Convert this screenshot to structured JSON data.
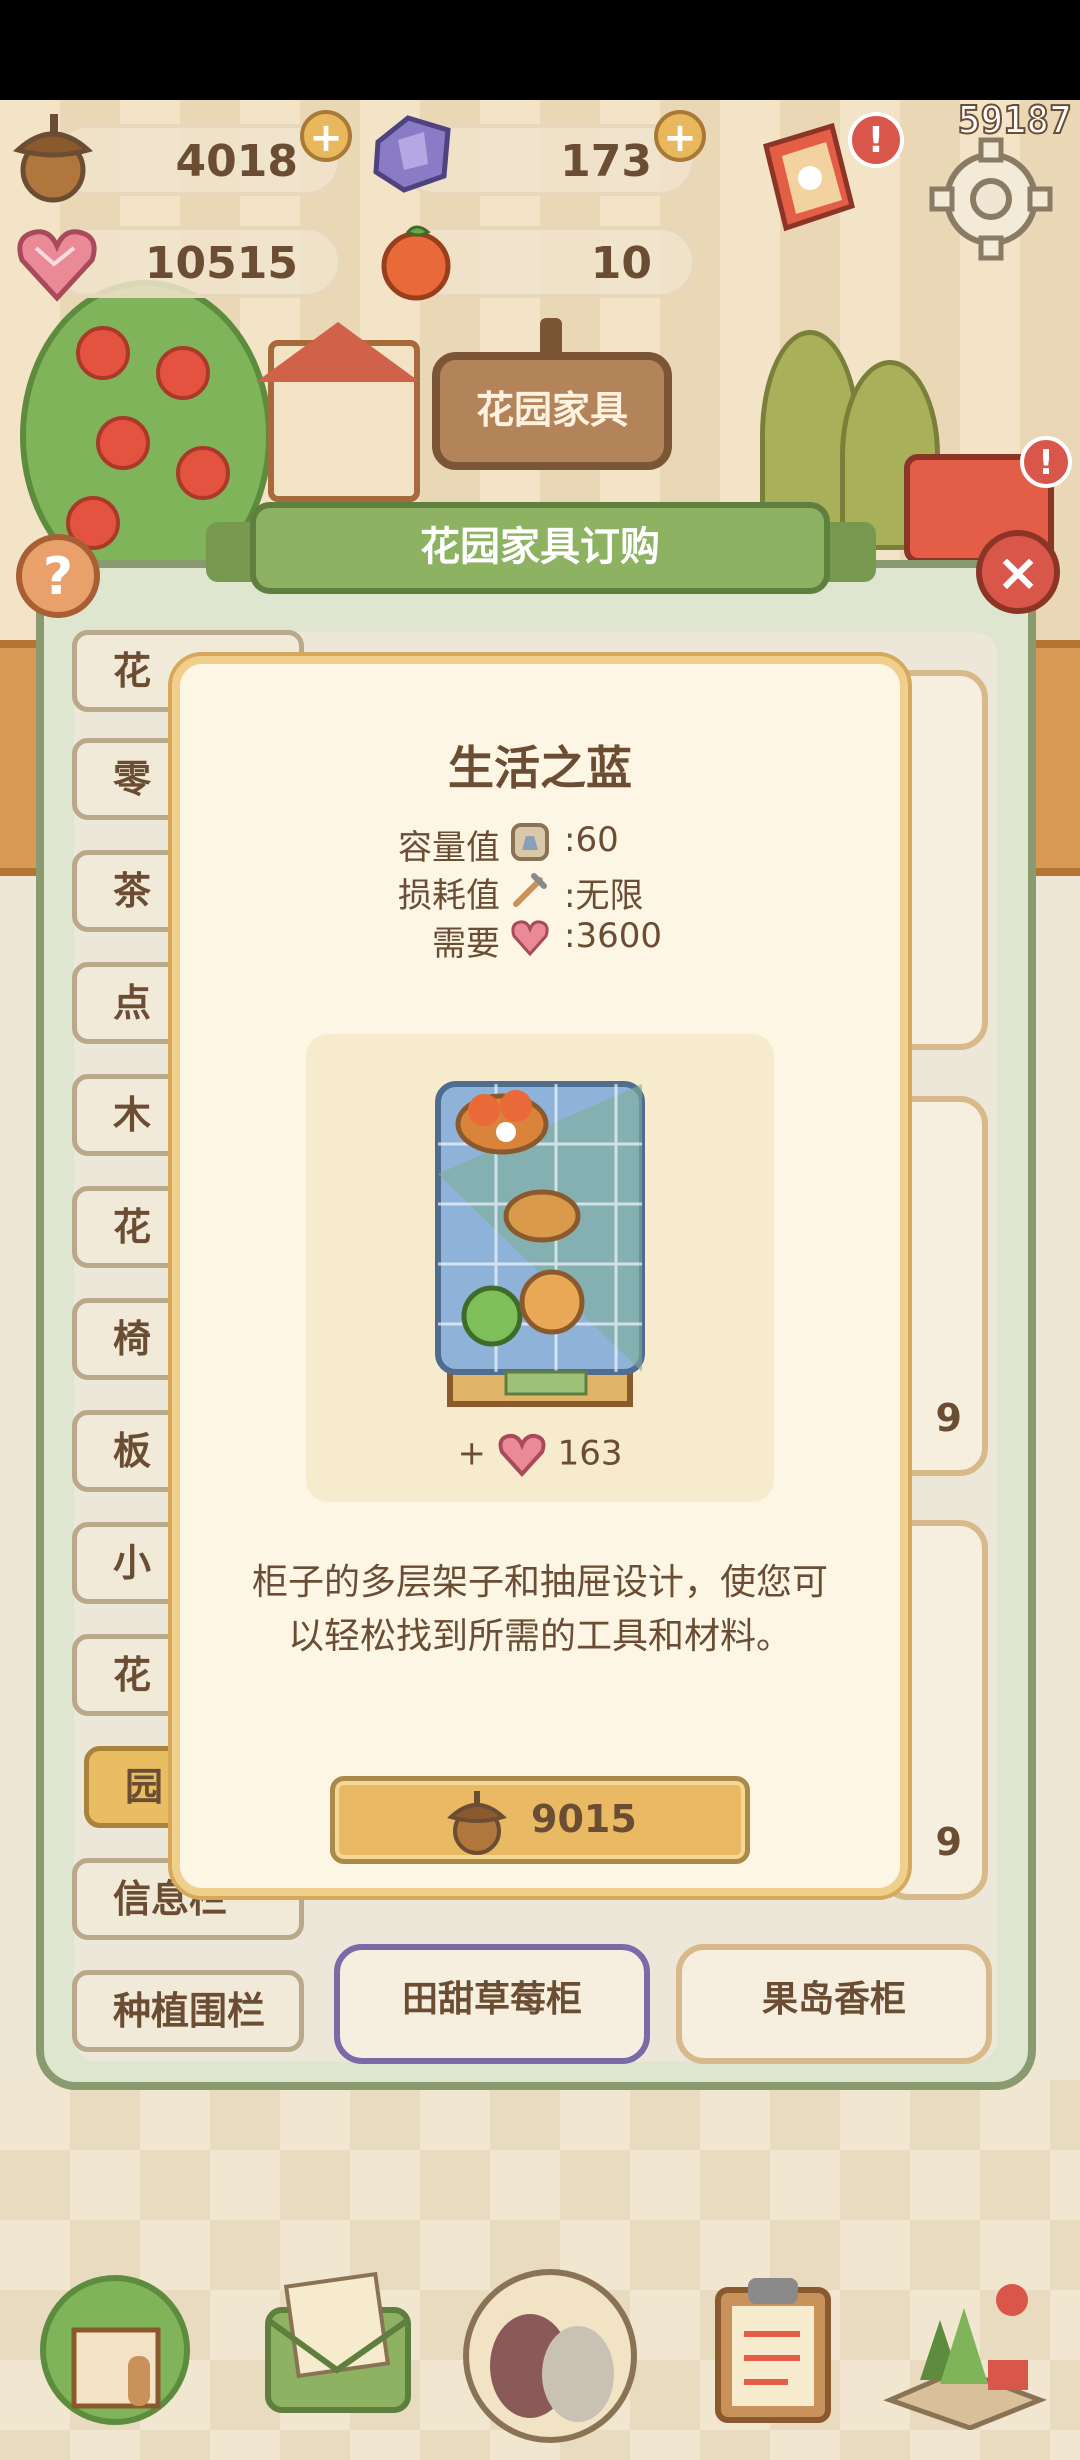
{
  "hud": {
    "acorns": "4018",
    "gems": "173",
    "hearts": "10515",
    "oranges": "10",
    "counter": "59187",
    "plus": "+"
  },
  "sign": {
    "label": "花园家具"
  },
  "panel": {
    "title": "花园家具订购",
    "help": "?",
    "close": "×"
  },
  "tabs": [
    {
      "label": "花"
    },
    {
      "label": "零"
    },
    {
      "label": "茶"
    },
    {
      "label": "点"
    },
    {
      "label": "木"
    },
    {
      "label": "花"
    },
    {
      "label": "椅"
    },
    {
      "label": "板"
    },
    {
      "label": "小"
    },
    {
      "label": "花"
    },
    {
      "label": "园"
    },
    {
      "label": "信息栏"
    },
    {
      "label": "种植围栏"
    }
  ],
  "items": [
    {
      "title": "",
      "price": "9"
    },
    {
      "title": "",
      "price": "9"
    },
    {
      "title": "田甜草莓柜",
      "price": ""
    },
    {
      "title": "果岛香柜",
      "price": ""
    }
  ],
  "dialog": {
    "title": "生活之蓝",
    "capacity_label": "容量值",
    "capacity_value": ":60",
    "wear_label": "损耗值",
    "wear_value": ":无限",
    "need_label": "需要",
    "need_value": ":3600",
    "bonus_prefix": "+",
    "bonus_value": "163",
    "description_line1": "柜子的多层架子和抽屉设计，使您可",
    "description_line2": "以轻松找到所需的工具和材料。",
    "buy_price": "9015"
  },
  "colors": {
    "accent": "#e9ba63",
    "panel_green": "#8db262",
    "heart_pink": "#e77b86",
    "close_red": "#d9574a"
  },
  "icons": {
    "acorn": "acorn-icon",
    "gem": "crystal-icon",
    "heart": "heart-gem-icon",
    "orange": "orange-icon",
    "settings": "gear-icon",
    "close": "close-icon",
    "help": "question-icon"
  }
}
